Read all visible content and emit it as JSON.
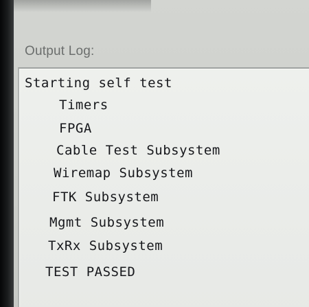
{
  "output_log": {
    "label": "Output Log:",
    "lines": [
      "Starting self test",
      "Timers",
      "FPGA",
      "Cable Test Subsystem",
      "Wiremap Subsystem",
      "FTK Subsystem",
      "Mgmt Subsystem",
      "TxRx Subsystem",
      "TEST PASSED"
    ]
  },
  "colors": {
    "panel_background": "#eef0ed",
    "window_background": "#d3d5d1",
    "text": "#17181c",
    "label_text": "#6b6e6d"
  }
}
